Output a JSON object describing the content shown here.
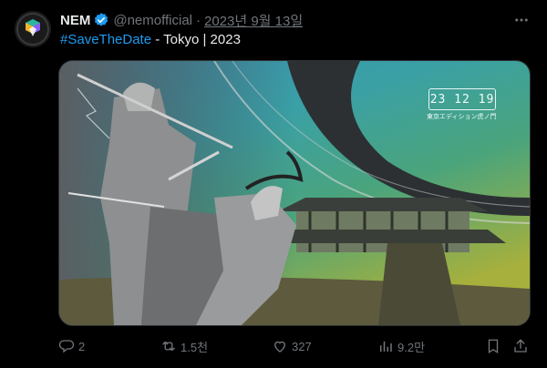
{
  "tweet": {
    "display_name": "NEM",
    "handle": "@nemofficial",
    "separator": "·",
    "date": "2023년 9월 13일",
    "hashtag": "#SaveTheDate",
    "text_rest": " - Tokyo | 2023"
  },
  "media": {
    "date_badge": "23 12 19",
    "venue": "東京エディション虎ノ門"
  },
  "actions": {
    "replies": "2",
    "retweets": "1.5천",
    "likes": "327",
    "views": "9.2만"
  },
  "colors": {
    "background": "#000000",
    "text": "#e7e9ea",
    "muted": "#71767b",
    "link": "#1d9bf0",
    "verified": "#1d9bf0"
  },
  "icons": [
    "more-icon",
    "verified-icon",
    "reply-icon",
    "retweet-icon",
    "like-icon",
    "views-icon",
    "bookmark-icon",
    "share-icon"
  ]
}
